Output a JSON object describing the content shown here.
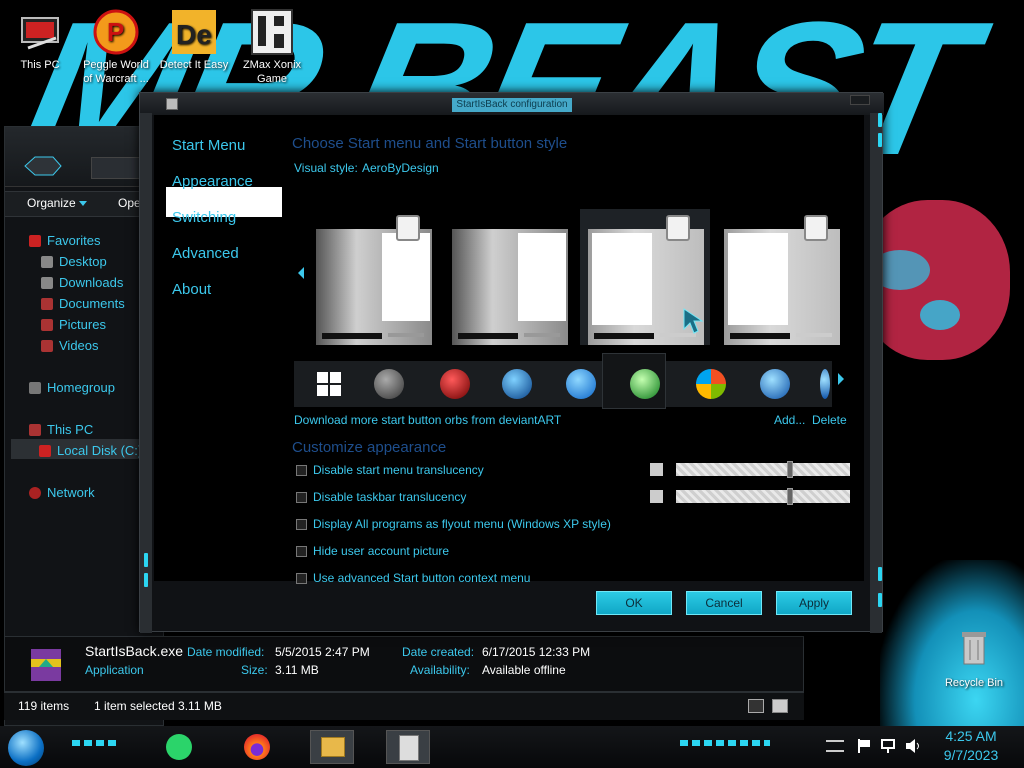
{
  "desktop": {
    "icons": [
      {
        "label": "This PC"
      },
      {
        "label": "Peggle World of Warcraft ..."
      },
      {
        "label": "Detect It Easy"
      },
      {
        "label": "ZMax Xonix Game"
      }
    ],
    "recycle_bin": "Recycle Bin"
  },
  "explorer": {
    "toolbar": {
      "organize": "Organize",
      "open": "Open"
    },
    "nav": {
      "favorites": "Favorites",
      "desktop": "Desktop",
      "downloads": "Downloads",
      "documents": "Documents",
      "pictures": "Pictures",
      "videos": "Videos",
      "homegroup": "Homegroup",
      "this_pc": "This PC",
      "local_disk": "Local Disk (C:)",
      "network": "Network"
    },
    "details": {
      "file_name": "StartIsBack.exe",
      "type": "Application",
      "date_modified_label": "Date modified:",
      "date_modified": "5/5/2015 2:47 PM",
      "size_label": "Size:",
      "size": "3.11 MB",
      "date_created_label": "Date created:",
      "date_created": "6/17/2015 12:33 PM",
      "availability_label": "Availability:",
      "availability": "Available offline"
    },
    "status": {
      "items": "119 items",
      "selected": "1 item selected  3.11 MB"
    }
  },
  "dialog": {
    "title": "StartIsBack configuration",
    "sidebar": {
      "start_menu": "Start Menu",
      "appearance": "Appearance",
      "switching": "Switching",
      "advanced": "Advanced",
      "about": "About"
    },
    "style_heading": "Choose Start menu and Start button style",
    "visual_style_label": "Visual style:",
    "visual_style_value": "AeroByDesign",
    "download_link": "Download more start button orbs from deviantART",
    "add_link": "Add...",
    "delete_link": "Delete",
    "customize_heading": "Customize appearance",
    "options": [
      {
        "label": "Disable start menu translucency",
        "checked": false,
        "slider": 0.66
      },
      {
        "label": "Disable taskbar translucency",
        "checked": false,
        "slider": 0.66
      },
      {
        "label": "Display All programs as flyout menu (Windows XP style)",
        "checked": false
      },
      {
        "label": "Hide user account picture",
        "checked": false
      },
      {
        "label": "Use advanced Start button context menu",
        "checked": false
      }
    ],
    "buttons": {
      "ok": "OK",
      "cancel": "Cancel",
      "apply": "Apply"
    },
    "accent": "#3cc8ec"
  },
  "taskbar": {
    "clock_time": "4:25 AM",
    "clock_date": "9/7/2023",
    "apps": [
      "start-orb-icon",
      "notes-icon",
      "firefox-icon",
      "file-explorer-icon",
      "startisback-icon"
    ]
  }
}
